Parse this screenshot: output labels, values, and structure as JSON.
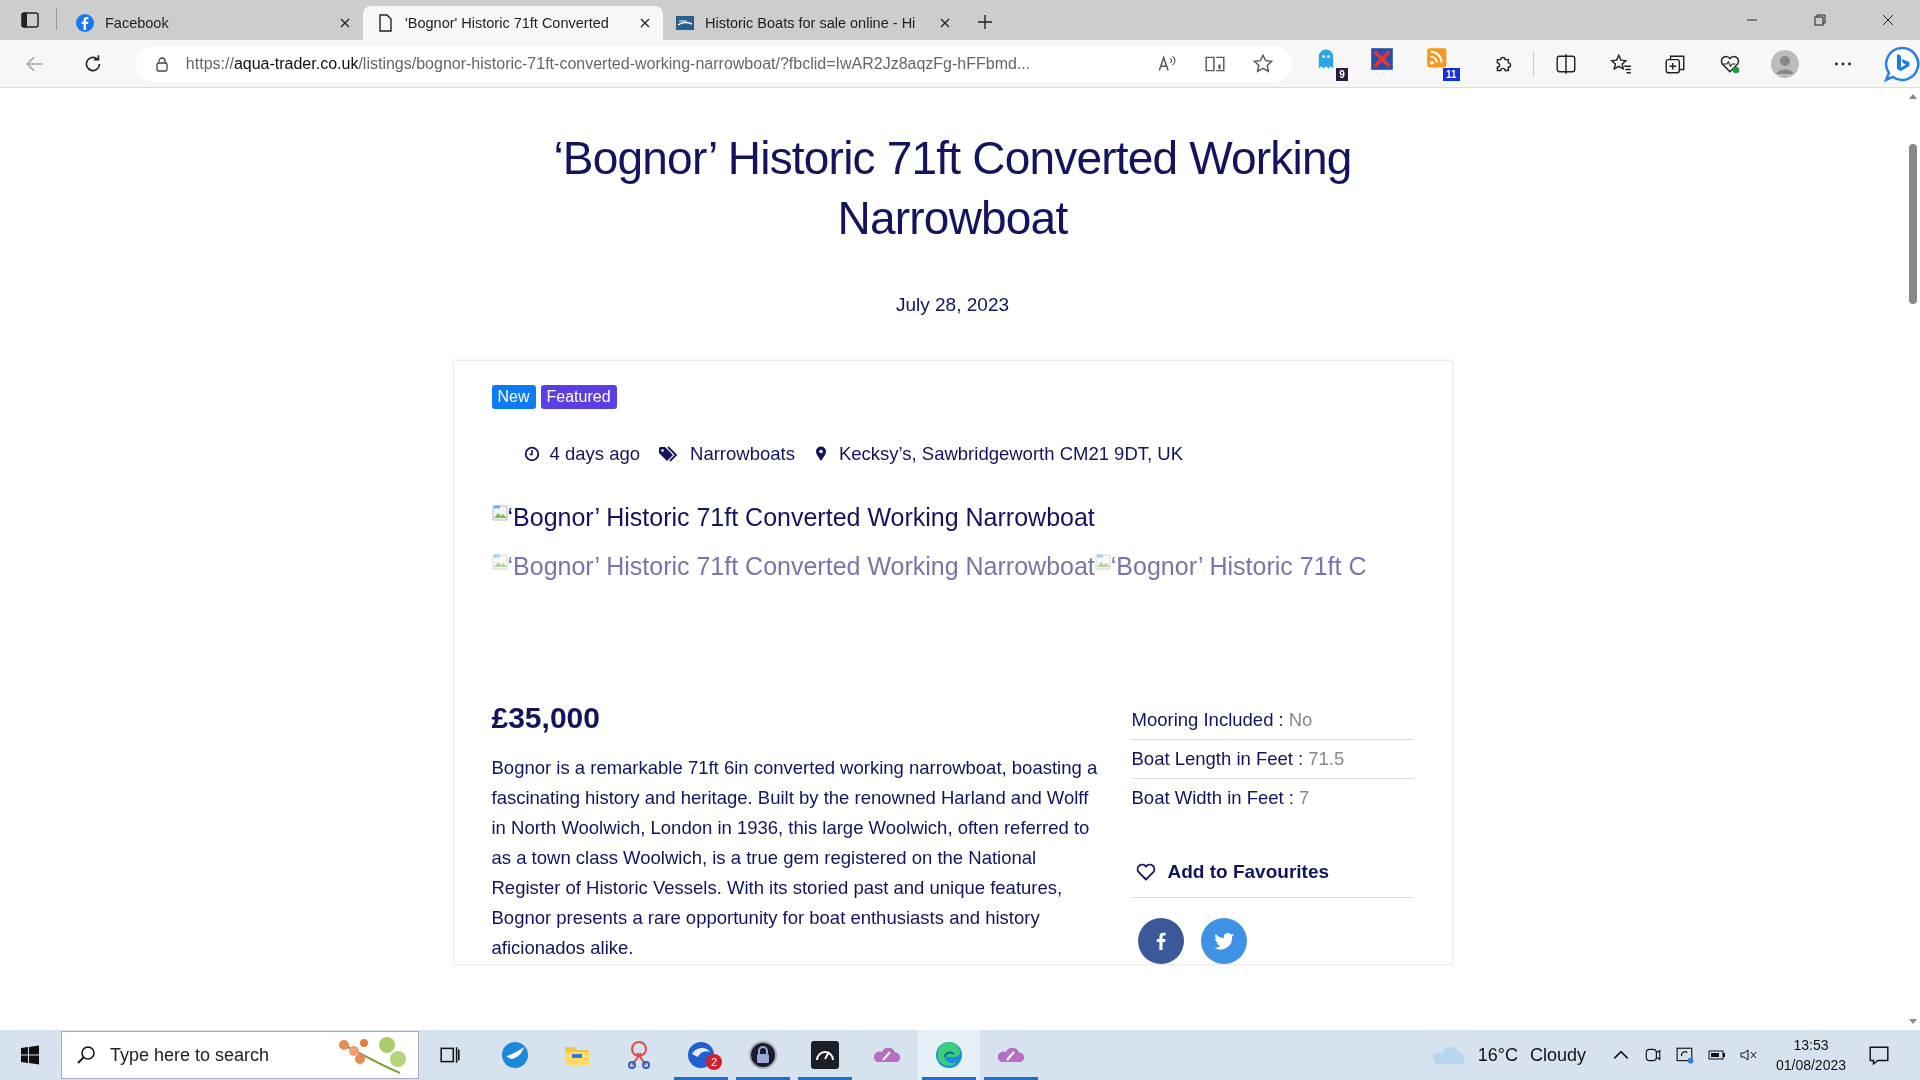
{
  "browser": {
    "tabs": [
      {
        "title": "Facebook",
        "kind": "facebook",
        "selected": false
      },
      {
        "title": "'Bognor' Historic 71ft Converted",
        "kind": "page",
        "selected": true
      },
      {
        "title": "Historic Boats for sale online - Hi",
        "kind": "boat",
        "selected": false
      }
    ],
    "address": {
      "scheme": "https://",
      "host": "aqua-trader.co.uk",
      "path": "/listings/bognor-historic-71ft-converted-working-narrowboat/?fbclid=IwAR2Jz8aqzFg-hFFbmd..."
    },
    "extensions": [
      {
        "kind": "ghost",
        "badge": "9"
      },
      {
        "kind": "tools"
      },
      {
        "kind": "rss",
        "badge": "11"
      }
    ]
  },
  "listing": {
    "title": "‘Bognor’ Historic 71ft Converted Working Narrowboat",
    "date": "July 28, 2023",
    "badges": [
      {
        "label": "New",
        "color": "#0d7cf2"
      },
      {
        "label": "Featured",
        "color": "#5b3fe0"
      }
    ],
    "meta": [
      {
        "kind": "time",
        "text": "4 days ago"
      },
      {
        "kind": "category",
        "text": "Narrowboats"
      },
      {
        "kind": "location",
        "text": "Kecksy’s, Sawbridgeworth CM21 9DT, UK"
      }
    ],
    "main_image_alt": "‘Bognor’ Historic 71ft Converted Working Narrowboat",
    "thumbnail_alts": [
      "‘Bognor’ Historic 71ft Converted Working Narrowboat",
      "‘Bognor’ Historic 71ft C"
    ],
    "price": "£35,000",
    "description": "Bognor is a remarkable 71ft 6in converted working narrowboat, boasting a fascinating history and heritage. Built by the renowned Harland and Wolff in North Woolwich, London in 1936, this large Woolwich, often referred to as a town class Woolwich, is a true gem registered on the National Register of Historic Vessels. With its storied past and unique features, Bognor presents a rare opportunity for boat enthusiasts and history aficionados alike.",
    "specs": [
      {
        "label": "Mooring Included :",
        "value": "No"
      },
      {
        "label": "Boat Length in Feet :",
        "value": "71.5"
      },
      {
        "label": "Boat Width in Feet :",
        "value": "7"
      }
    ],
    "favourites": "Add to Favourites",
    "share": [
      {
        "kind": "facebook"
      },
      {
        "kind": "twitter"
      }
    ]
  },
  "taskbar": {
    "search_placeholder": "Type here to search",
    "apps": [
      {
        "kind": "bird",
        "running": false,
        "active": false
      },
      {
        "kind": "folder",
        "running": false,
        "active": false
      },
      {
        "kind": "scissors",
        "running": false,
        "active": false
      },
      {
        "kind": "mail",
        "badge": "2",
        "running": true,
        "active": false
      },
      {
        "kind": "lock",
        "running": true,
        "active": false
      },
      {
        "kind": "gauge",
        "running": true,
        "active": false
      },
      {
        "kind": "cloud",
        "running": false,
        "active": false
      },
      {
        "kind": "browser",
        "running": true,
        "active": true
      },
      {
        "kind": "cloud",
        "running": true,
        "active": false
      }
    ],
    "temperature": "16°C",
    "weather": "Cloudy",
    "time": "13:53",
    "date": "01/08/2023"
  }
}
